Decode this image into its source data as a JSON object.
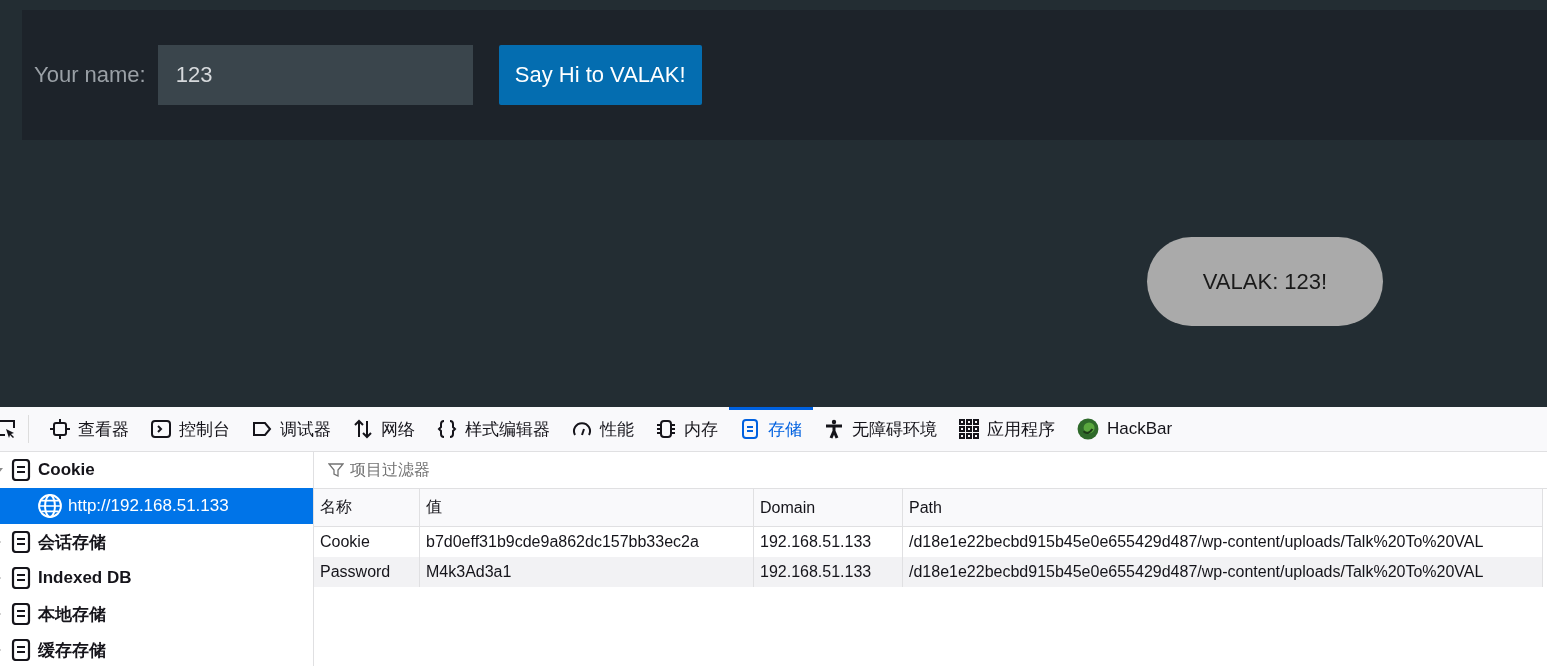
{
  "form": {
    "label": "Your name:",
    "name_field": {
      "value": "123"
    },
    "button": "Say Hi to VALAK!"
  },
  "chat_bubble": "VALAK: 123!",
  "devtools": {
    "tabs": [
      {
        "label": "查看器",
        "selected": false
      },
      {
        "label": "控制台",
        "selected": false
      },
      {
        "label": "调试器",
        "selected": false
      },
      {
        "label": "网络",
        "selected": false
      },
      {
        "label": "样式编辑器",
        "selected": false
      },
      {
        "label": "性能",
        "selected": false
      },
      {
        "label": "内存",
        "selected": false
      },
      {
        "label": "存储",
        "selected": true
      },
      {
        "label": "无障碍环境",
        "selected": false
      },
      {
        "label": "应用程序",
        "selected": false
      },
      {
        "label": "HackBar",
        "selected": false
      }
    ],
    "storage_tree": [
      {
        "label": "Cookie",
        "expanded": true,
        "selected": false,
        "children": [
          {
            "label": "http://192.168.51.133",
            "selected": true
          }
        ]
      },
      {
        "label": "会话存储",
        "expanded": false,
        "selected": false
      },
      {
        "label": "Indexed DB",
        "expanded": false,
        "selected": false
      },
      {
        "label": "本地存储",
        "expanded": false,
        "selected": false
      },
      {
        "label": "缓存存储",
        "expanded": false,
        "selected": false
      }
    ],
    "filter": {
      "placeholder": "项目过滤器"
    },
    "table": {
      "columns": [
        "名称",
        "值",
        "Domain",
        "Path"
      ],
      "rows": [
        [
          "Cookie",
          "b7d0eff31b9cde9a862dc157bb33ec2a",
          "192.168.51.133",
          "/d18e1e22becbd915b45e0e655429d487/wp-content/uploads/Talk%20To%20VAL"
        ],
        [
          "Password",
          "M4k3Ad3a1",
          "192.168.51.133",
          "/d18e1e22becbd915b45e0e655429d487/wp-content/uploads/Talk%20To%20VAL"
        ]
      ]
    }
  }
}
